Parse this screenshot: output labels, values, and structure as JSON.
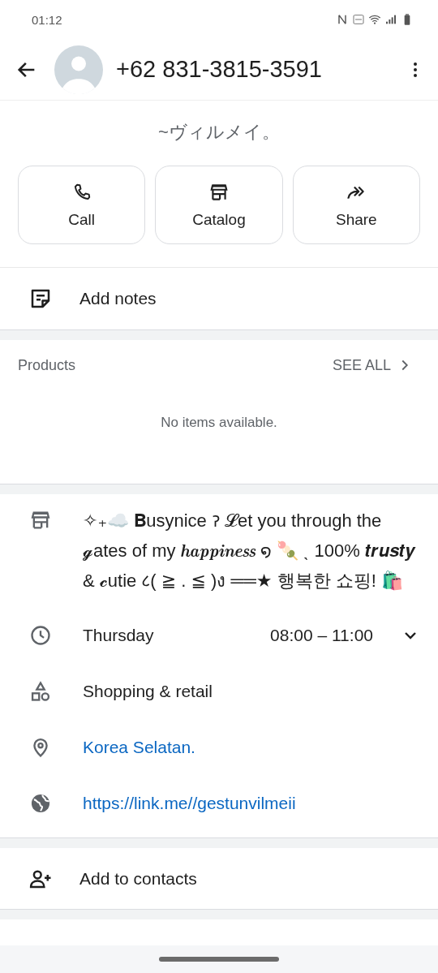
{
  "status_bar": {
    "time": "01:12"
  },
  "header": {
    "title": "+62 831-3815-3591"
  },
  "profile": {
    "subtitle": "~ヴィルメイ。"
  },
  "actions": [
    {
      "kind": "call",
      "label": "Call"
    },
    {
      "kind": "catalog",
      "label": "Catalog"
    },
    {
      "kind": "share",
      "label": "Share"
    }
  ],
  "notes": {
    "label": "Add notes"
  },
  "products": {
    "title": "Products",
    "see_all": "SEE ALL",
    "empty": "No items available."
  },
  "info": [
    {
      "kind": "description",
      "text": "✧₊☁️ 𝐁usynice ॽ 𝓛et you through the 𝓰ates of my 𝒉𝒂𝒑𝒑𝒊𝒏𝒆𝒔𝒔 ໑ 🍡 ˎ 100% 𝒕𝒓𝒖𝒔𝒕𝒚 & 𝓬utie ८( ≧ . ≦ )ง ══★ 행복한 쇼핑! 🛍️"
    },
    {
      "kind": "hours",
      "text": "Thursday",
      "hours": "08:00 – 11:00",
      "expanded": false
    },
    {
      "kind": "category",
      "text": "Shopping & retail"
    },
    {
      "kind": "address",
      "text": "Korea Selatan."
    },
    {
      "kind": "website",
      "text": "https://link.me//gestunvilmeii"
    }
  ],
  "add_contact": {
    "label": "Add to contacts"
  }
}
